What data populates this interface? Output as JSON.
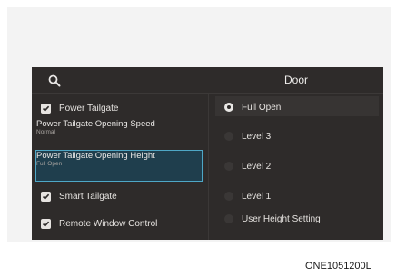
{
  "header": {
    "title": "Door",
    "search_icon": "search-icon"
  },
  "left_panel": {
    "power_tailgate": {
      "label": "Power Tailgate",
      "checked": true
    },
    "opening_speed": {
      "name": "Power Tailgate Opening Speed",
      "value": "Normal"
    },
    "opening_height": {
      "name": "Power Tailgate Opening Height",
      "value": "Full Open"
    },
    "smart_tailgate": {
      "label": "Smart Tailgate",
      "checked": true
    },
    "remote_window": {
      "label": "Remote Window Control",
      "checked": true
    }
  },
  "right_panel": {
    "options": [
      {
        "label": "Full Open",
        "selected": true
      },
      {
        "label": "Level 3",
        "selected": false
      },
      {
        "label": "Level 2",
        "selected": false
      },
      {
        "label": "Level 1",
        "selected": false
      },
      {
        "label": "User Height Setting",
        "selected": false
      }
    ]
  },
  "caption": "ONE1051200L",
  "colors": {
    "screen_bg": "#2e2b2a",
    "highlight_border": "#4ea7c6",
    "highlight_bg": "#1f3e4d"
  }
}
